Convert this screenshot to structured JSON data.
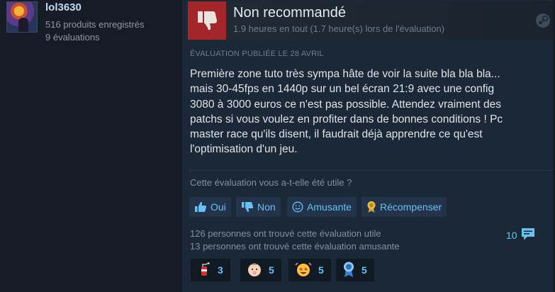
{
  "author": {
    "name": "lol3630",
    "products": "516 produits enregistrés",
    "reviews": "9 évaluations"
  },
  "review": {
    "verdict": "Non recommandé",
    "hours": "1.9 heures en tout (1.7 heure(s) lors de l'évaluation)",
    "posted": "ÉVALUATION PUBLIÉE LE 28 AVRIL",
    "text_lines": [
      "Première zone tuto très sympa hâte de voir la suite bla bla bla...",
      "mais 30-45fps en 1440p sur un bel écran 21:9 avec une config",
      "3080 à 3000 euros ce n'est pas possible. Attendez vraiment des",
      "patchs si vous voulez en profiter dans de bonnes conditions ! Pc",
      "master race qu'ils disent, il faudrait déjà apprendre ce qu'est",
      "l'optimisation d'un jeu."
    ]
  },
  "helpful": {
    "question": "Cette évaluation vous a-t-elle été utile ?",
    "buttons": {
      "yes": "Oui",
      "no": "Non",
      "funny": "Amusante",
      "award": "Récompenser"
    },
    "stats": {
      "helpful_count": "126 personnes ont trouvé cette évaluation utile",
      "funny_count": "13 personnes ont trouvé cette évaluation amusante"
    },
    "comments": "10"
  },
  "awards": [
    {
      "icon": "fire-extinguisher-icon",
      "count": "3"
    },
    {
      "icon": "baby-face-icon",
      "count": "5"
    },
    {
      "icon": "star-struck-face-icon",
      "count": "5"
    },
    {
      "icon": "award-ribbon-icon",
      "count": "5"
    }
  ],
  "colors": {
    "background": "#161c26",
    "review_bg": "#1b2838",
    "thumb_down_bg": "#a3262a",
    "accent": "#67c1f5",
    "button_bg": "#23334a"
  }
}
